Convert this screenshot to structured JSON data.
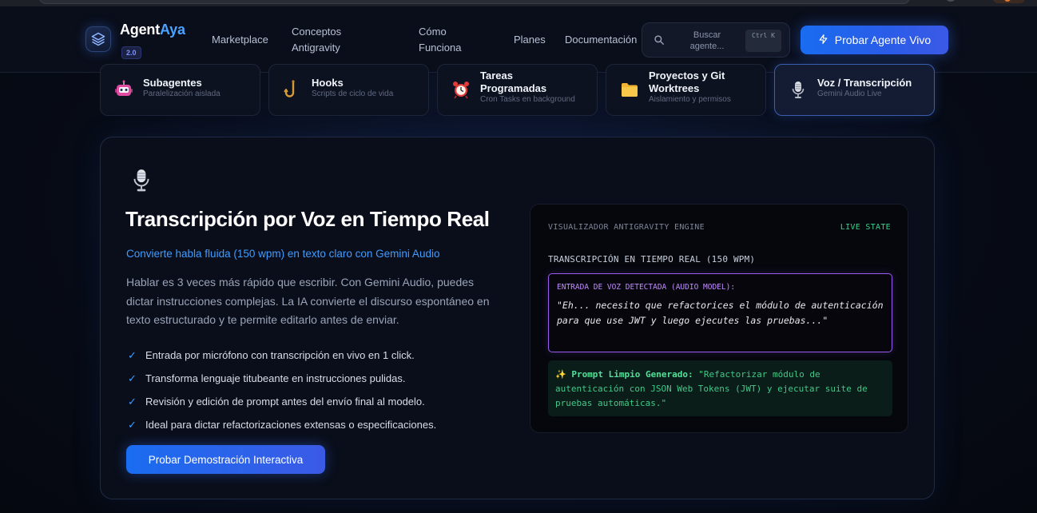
{
  "brand": {
    "name_prefix": "Agent",
    "name_accent": "Aya",
    "version": "2.0"
  },
  "nav": [
    {
      "label": "Marketplace"
    },
    {
      "label": "Conceptos Antigravity"
    },
    {
      "label": "Cómo Funciona"
    },
    {
      "label": "Planes"
    },
    {
      "label": "Documentación"
    }
  ],
  "search": {
    "placeholder": "Buscar agente...",
    "shortcut": "Ctrl K"
  },
  "header_cta": {
    "label": "Probar Agente Vivo",
    "icon": "lightning-icon"
  },
  "tabs": [
    {
      "title": "Subagentes",
      "subtitle": "Paralelización aislada",
      "icon": "robot-icon",
      "active": false
    },
    {
      "title": "Hooks",
      "subtitle": "Scripts de ciclo de vida",
      "icon": "hook-icon",
      "active": false
    },
    {
      "title": "Tareas Programadas",
      "subtitle": "Cron Tasks en background",
      "icon": "alarm-clock-icon",
      "active": false
    },
    {
      "title": "Proyectos y Git Worktrees",
      "subtitle": "Aislamiento y permisos",
      "icon": "folder-icon",
      "active": false
    },
    {
      "title": "Voz / Transcripción",
      "subtitle": "Gemini Audio Live",
      "icon": "microphone-icon",
      "active": true
    }
  ],
  "feature": {
    "icon": "microphone-icon",
    "title": "Transcripción por Voz en Tiempo Real",
    "subtitle": "Convierte habla fluida (150 wpm) en texto claro con Gemini Audio",
    "description": "Hablar es 3 veces más rápido que escribir. Con Gemini Audio, puedes dictar instrucciones complejas. La IA convierte el discurso espontáneo en texto estructurado y te permite editarlo antes de enviar.",
    "bullets": [
      "Entrada por micrófono con transcripción en vivo en 1 click.",
      "Transforma lenguaje titubeante en instrucciones pulidas.",
      "Revisión y edición de prompt antes del envío final al modelo.",
      "Ideal para dictar refactorizaciones extensas o especificaciones."
    ],
    "cta": "Probar Demostración Interactiva"
  },
  "visualizer": {
    "header": "VISUALIZADOR ANTIGRAVITY ENGINE",
    "state": "LIVE STATE",
    "title": "TRANSCRIPCIÓN EN TIEMPO REAL (150 WPM)",
    "input_label": "ENTRADA DE VOZ DETECTADA (AUDIO MODEL):",
    "input_text": "\"Eh... necesito que refactorices el módulo de autenticación para que use JWT y luego ejecutes las pruebas...\"",
    "output_label": "✨ Prompt Limpio Generado:",
    "output_text": " \"Refactorizar módulo de autenticación con JSON Web Tokens (JWT) y ejecutar suite de pruebas automáticas.\""
  },
  "colors": {
    "accent": "#3f9cff",
    "button": "#1a6cf0",
    "live": "#3ad18a",
    "voice_border": "#9a5cf0",
    "output_text": "#41c98a"
  }
}
